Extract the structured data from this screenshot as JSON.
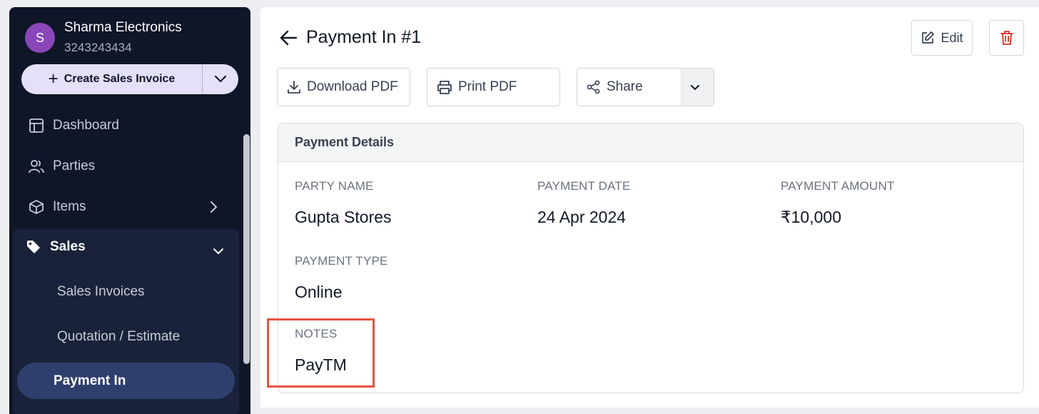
{
  "sidebar": {
    "business": {
      "initial": "S",
      "name": "Sharma Electronics",
      "phone": "3243243434"
    },
    "create_button": "Create Sales Invoice",
    "items": [
      {
        "label": "Dashboard",
        "icon": "dashboard-icon"
      },
      {
        "label": "Parties",
        "icon": "users-icon"
      },
      {
        "label": "Items",
        "icon": "box-icon"
      }
    ],
    "sales": {
      "label": "Sales",
      "sub_items": [
        "Sales Invoices",
        "Quotation / Estimate",
        "Payment In"
      ],
      "active": "Payment In"
    }
  },
  "header": {
    "title": "Payment In #1",
    "edit_label": "Edit"
  },
  "actions": {
    "download": "Download PDF",
    "print": "Print PDF",
    "share": "Share"
  },
  "details": {
    "heading": "Payment Details",
    "party_name_label": "PARTY NAME",
    "party_name": "Gupta Stores",
    "payment_date_label": "PAYMENT DATE",
    "payment_date": "24 Apr 2024",
    "payment_amount_label": "PAYMENT AMOUNT",
    "payment_amount": "₹10,000",
    "payment_type_label": "PAYMENT TYPE",
    "payment_type": "Online",
    "notes_label": "NOTES",
    "notes": "PayTM"
  },
  "colors": {
    "sidebar_bg": "#0e1628",
    "avatar": "#8a47b9",
    "create_button_bg": "#e3e0f7",
    "active_item": "#2f3f6d",
    "delete_red": "#d92d20",
    "highlight_border": "#e8543f"
  }
}
